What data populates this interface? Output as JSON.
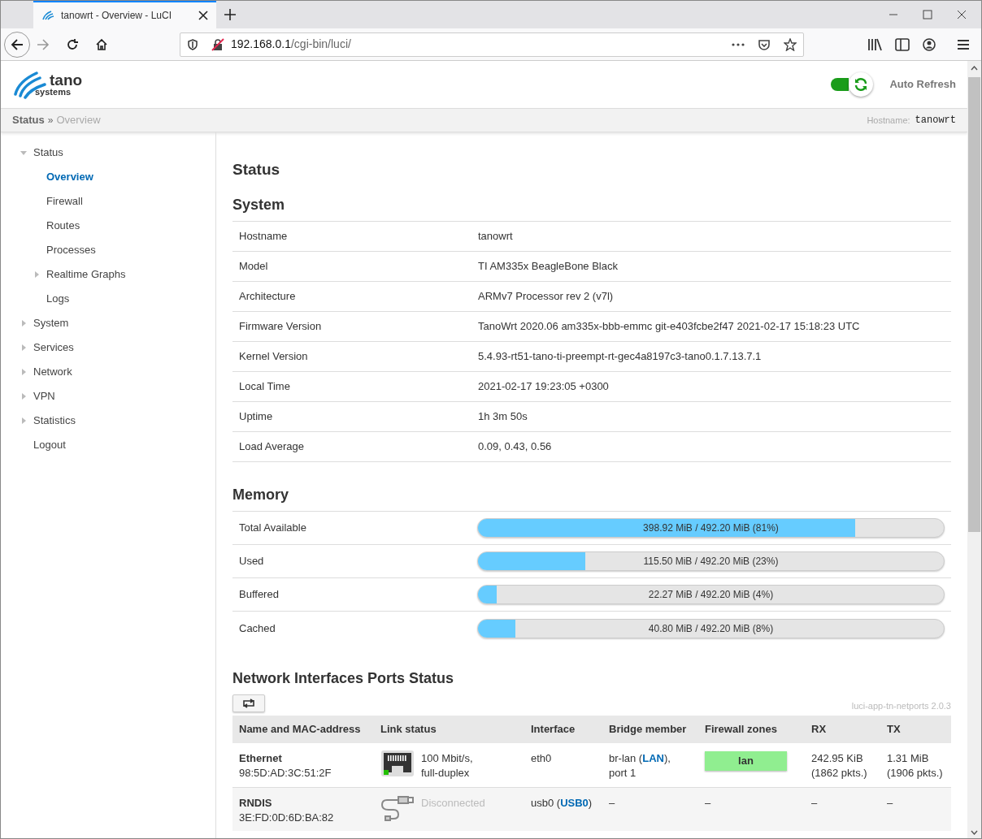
{
  "browser": {
    "tab_title": "tanowrt - Overview - LuCI",
    "url_host": "192.168.0.1",
    "url_path": "/cgi-bin/luci/"
  },
  "header": {
    "logo_top": "tano",
    "logo_bottom": "systems",
    "auto_refresh": {
      "label": "Auto Refresh",
      "on": true
    }
  },
  "breadcrumb": {
    "parent": "Status",
    "separator": "»",
    "current": "Overview",
    "hostname_label": "Hostname:",
    "hostname": "tanowrt"
  },
  "sidebar": [
    {
      "label": "Status",
      "kind": "branch",
      "expanded": true,
      "children": [
        {
          "label": "Overview",
          "kind": "leaf",
          "selected": true
        },
        {
          "label": "Firewall",
          "kind": "leaf",
          "selected": false
        },
        {
          "label": "Routes",
          "kind": "leaf",
          "selected": false
        },
        {
          "label": "Processes",
          "kind": "leaf",
          "selected": false
        },
        {
          "label": "Realtime Graphs",
          "kind": "branch",
          "expanded": false,
          "selected": false
        },
        {
          "label": "Logs",
          "kind": "leaf",
          "selected": false
        }
      ]
    },
    {
      "label": "System",
      "kind": "branch",
      "expanded": false
    },
    {
      "label": "Services",
      "kind": "branch",
      "expanded": false
    },
    {
      "label": "Network",
      "kind": "branch",
      "expanded": false
    },
    {
      "label": "VPN",
      "kind": "branch",
      "expanded": false
    },
    {
      "label": "Statistics",
      "kind": "branch",
      "expanded": false
    },
    {
      "label": "Logout",
      "kind": "leaf"
    }
  ],
  "page_title": "Status",
  "system": {
    "title": "System",
    "rows": [
      {
        "label": "Hostname",
        "value": "tanowrt"
      },
      {
        "label": "Model",
        "value": "TI AM335x BeagleBone Black"
      },
      {
        "label": "Architecture",
        "value": "ARMv7 Processor rev 2 (v7l)"
      },
      {
        "label": "Firmware Version",
        "value": "TanoWrt 2020.06 am335x-bbb-emmc git-e403fcbe2f47 2021-02-17 15:18:23 UTC"
      },
      {
        "label": "Kernel Version",
        "value": "5.4.93-rt51-tano-ti-preempt-rt-gec4a8197c3-tano0.1.7.13.7.1"
      },
      {
        "label": "Local Time",
        "value": "2021-02-17 19:23:05 +0300"
      },
      {
        "label": "Uptime",
        "value": "1h 3m 50s"
      },
      {
        "label": "Load Average",
        "value": "0.09, 0.43, 0.56"
      }
    ]
  },
  "memory": {
    "title": "Memory",
    "rows": [
      {
        "label": "Total Available",
        "level": 0.81,
        "reading": "398.92 MiB / 492.20 MiB (81%)"
      },
      {
        "label": "Used",
        "level": 0.23,
        "reading": "115.50 MiB / 492.20 MiB (23%)"
      },
      {
        "label": "Buffered",
        "level": 0.04,
        "reading": "22.27 MiB / 492.20 MiB (4%)"
      },
      {
        "label": "Cached",
        "level": 0.08,
        "reading": "40.80 MiB / 492.20 MiB (8%)"
      }
    ]
  },
  "ports": {
    "title": "Network Interfaces Ports Status",
    "version": "luci-app-tn-netports 2.0.3",
    "columns": [
      "Name and MAC-address",
      "Link status",
      "Interface",
      "Bridge member",
      "Firewall zones",
      "RX",
      "TX"
    ],
    "rows": [
      {
        "name": "Ethernet",
        "mac": "98:5D:AD:3C:51:2F",
        "kind": "ethernet",
        "connected": true,
        "link": [
          "100 Mbit/s,",
          "full-duplex"
        ],
        "interface": "eth0",
        "bridge": {
          "name": "br-lan (",
          "zone": "LAN",
          "after": "),",
          "port": "port 1"
        },
        "zone": {
          "label": "lan",
          "color": "#90ee90"
        },
        "rx": [
          "242.95 KiB",
          "(1862 pkts.)"
        ],
        "tx": [
          "1.31 MiB",
          "(1906 pkts.)"
        ]
      },
      {
        "name": "RNDIS",
        "mac": "3E:FD:0D:6D:BA:82",
        "kind": "usb",
        "connected": false,
        "link": [
          "Disconnected"
        ],
        "interface": "usb0 (",
        "interface_zone": "USB0",
        "interface_after": ")",
        "bridge_text": "–",
        "zone_text": "–",
        "rx": [
          "–"
        ],
        "tx": [
          "–"
        ]
      }
    ]
  }
}
